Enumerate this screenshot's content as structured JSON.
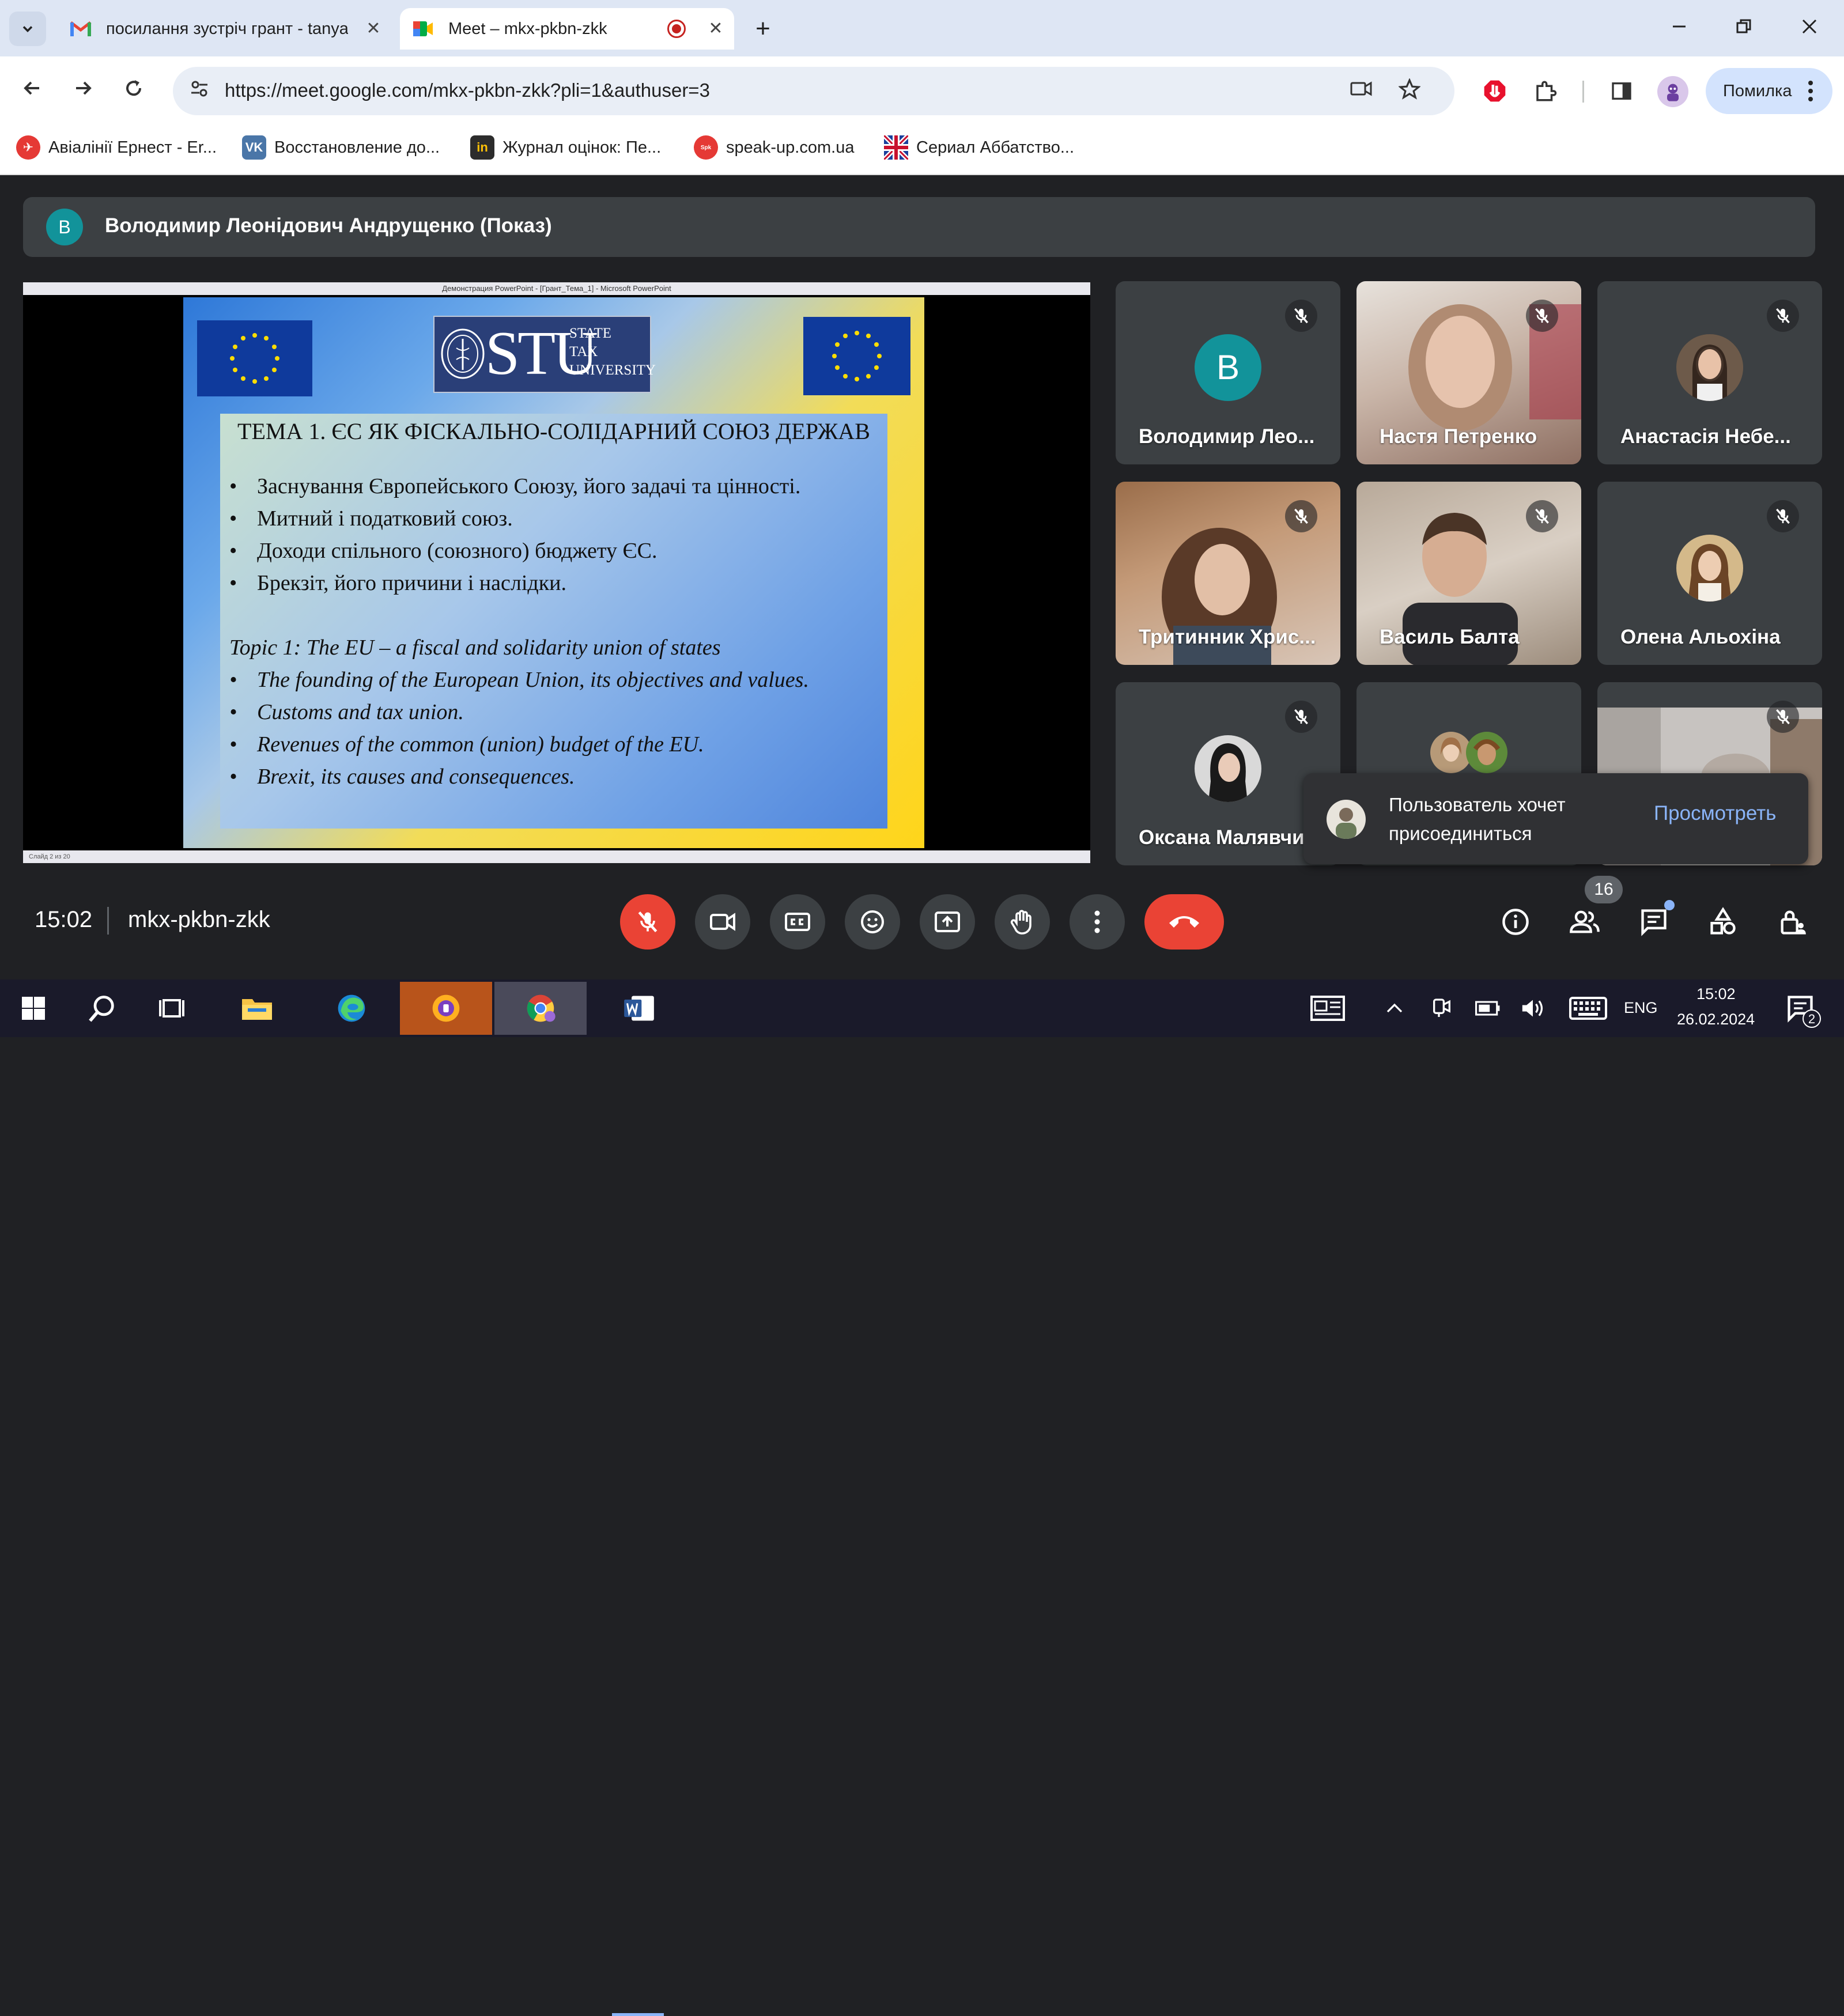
{
  "browser": {
    "tabs": [
      {
        "title": "посилання зустріч грант - tanya",
        "close": "✕"
      },
      {
        "title": "Meet – mkx-pkbn-zkk",
        "close": "✕"
      }
    ],
    "new_tab": "+",
    "url": "https://meet.google.com/mkx-pkbn-zkk?pli=1&authuser=3",
    "profile_label": "Помилка",
    "bookmarks": [
      {
        "label": "Авіалінії Ернест - Er...",
        "color": "#e53935"
      },
      {
        "label": "Восстановление до...",
        "color": "#4a76a8"
      },
      {
        "label": "Журнал оцінок: Пе...",
        "color": "#2c2c2c"
      },
      {
        "label": "speak-up.com.ua",
        "color": "#e53935"
      },
      {
        "label": "Сериал Аббатство...",
        "color": "#1a3f9c"
      }
    ]
  },
  "meet": {
    "presenter": {
      "initial": "В",
      "label": "Володимир Леонідович Андрущенко (Показ)"
    },
    "slide": {
      "window_title": "Демонстрация PowerPoint - [Грант_Тема_1] - Microsoft PowerPoint",
      "status": "Слайд 2 из 20",
      "logo_big": "STU",
      "logo_lines": [
        "STATE",
        "TAX",
        "UNIVERSITY"
      ],
      "title_ua": "ТЕМА 1. ЄС ЯК ФІСКАЛЬНО-СОЛІДАРНИЙ СОЮЗ ДЕРЖАВ",
      "bullet_mark": "•",
      "bullets_ua": [
        "Заснування Європейського Союзу, його задачі та цінності.",
        "Митний і податковий союз.",
        "Доходи спільного (союзного) бюджету ЄС.",
        "Брекзіт, його причини і наслідки."
      ],
      "title_en": "Topic 1: The EU – a fiscal and solidarity union of states",
      "bullets_en": [
        "The founding of the European Union, its objectives and values.",
        "Customs and tax union.",
        "Revenues of the common (union) budget of the EU.",
        "Brexit, its causes and consequences."
      ]
    },
    "participants": [
      {
        "name": "Володимир Лео...",
        "initial": "В"
      },
      {
        "name": "Настя Петренко"
      },
      {
        "name": "Анастасія Небе..."
      },
      {
        "name": "Тритинник Хрис..."
      },
      {
        "name": "Василь Балта"
      },
      {
        "name": "Олена Альохіна"
      },
      {
        "name": "Оксана Малявчи"
      },
      {
        "name": ""
      },
      {
        "name": ""
      }
    ],
    "notification": {
      "text": "Пользователь хочет присоединиться",
      "action": "Просмотреть"
    },
    "time": "15:02",
    "meeting_code": "mkx-pkbn-zkk",
    "people_count": "16",
    "colors": {
      "end_call": "#ea4335",
      "mic_off": "#ea4335",
      "accent": "#8ab4f8"
    }
  },
  "taskbar": {
    "lang": "ENG",
    "time": "15:02",
    "date": "26.02.2024",
    "notifications": "2"
  }
}
